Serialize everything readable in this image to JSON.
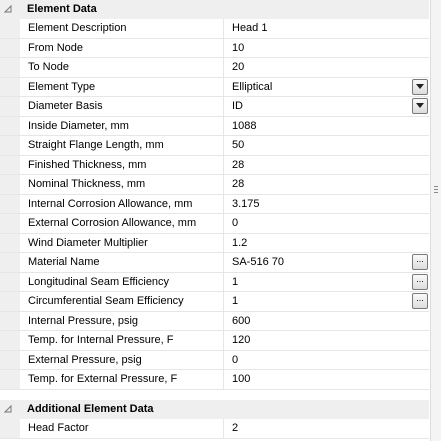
{
  "categories": [
    {
      "label": "Element Data",
      "expander": "collapse"
    },
    {
      "label": "Additional Element Data",
      "expander": "collapse"
    }
  ],
  "rows": [
    {
      "name": "Element Description",
      "value": "Head 1"
    },
    {
      "name": "From Node",
      "value": "10"
    },
    {
      "name": "To Node",
      "value": "20"
    },
    {
      "name": "Element Type",
      "value": "Elliptical",
      "control": "dropdown"
    },
    {
      "name": "Diameter Basis",
      "value": "ID",
      "control": "dropdown"
    },
    {
      "name": "Inside Diameter, mm",
      "value": "1088"
    },
    {
      "name": "Straight Flange Length, mm",
      "value": "50"
    },
    {
      "name": "Finished Thickness, mm",
      "value": "28"
    },
    {
      "name": "Nominal Thickness, mm",
      "value": "28"
    },
    {
      "name": "Internal Corrosion Allowance, mm",
      "value": "3.175"
    },
    {
      "name": "External Corrosion Allowance, mm",
      "value": "0"
    },
    {
      "name": "Wind Diameter Multiplier",
      "value": "1.2"
    },
    {
      "name": "Material Name",
      "value": "SA-516 70",
      "control": "ellipsis"
    },
    {
      "name": "Longitudinal Seam Efficiency",
      "value": "1",
      "control": "ellipsis"
    },
    {
      "name": "Circumferential Seam Efficiency",
      "value": "1",
      "control": "ellipsis"
    },
    {
      "name": "Internal Pressure, psig",
      "value": "600"
    },
    {
      "name": "Temp. for Internal Pressure, F",
      "value": "120"
    },
    {
      "name": "External Pressure, psig",
      "value": "0"
    },
    {
      "name": "Temp. for External Pressure, F",
      "value": "100"
    }
  ],
  "additional_rows": [
    {
      "name": "Head Factor",
      "value": "2"
    }
  ],
  "buttons": {
    "ellipsis_label": "..."
  },
  "icons": {
    "expander": "collapse-triangle-icon",
    "dropdown": "dropdown-arrow-icon"
  },
  "colors": {
    "category_bg": "#efefef",
    "grid_line": "#e6e6e6"
  }
}
